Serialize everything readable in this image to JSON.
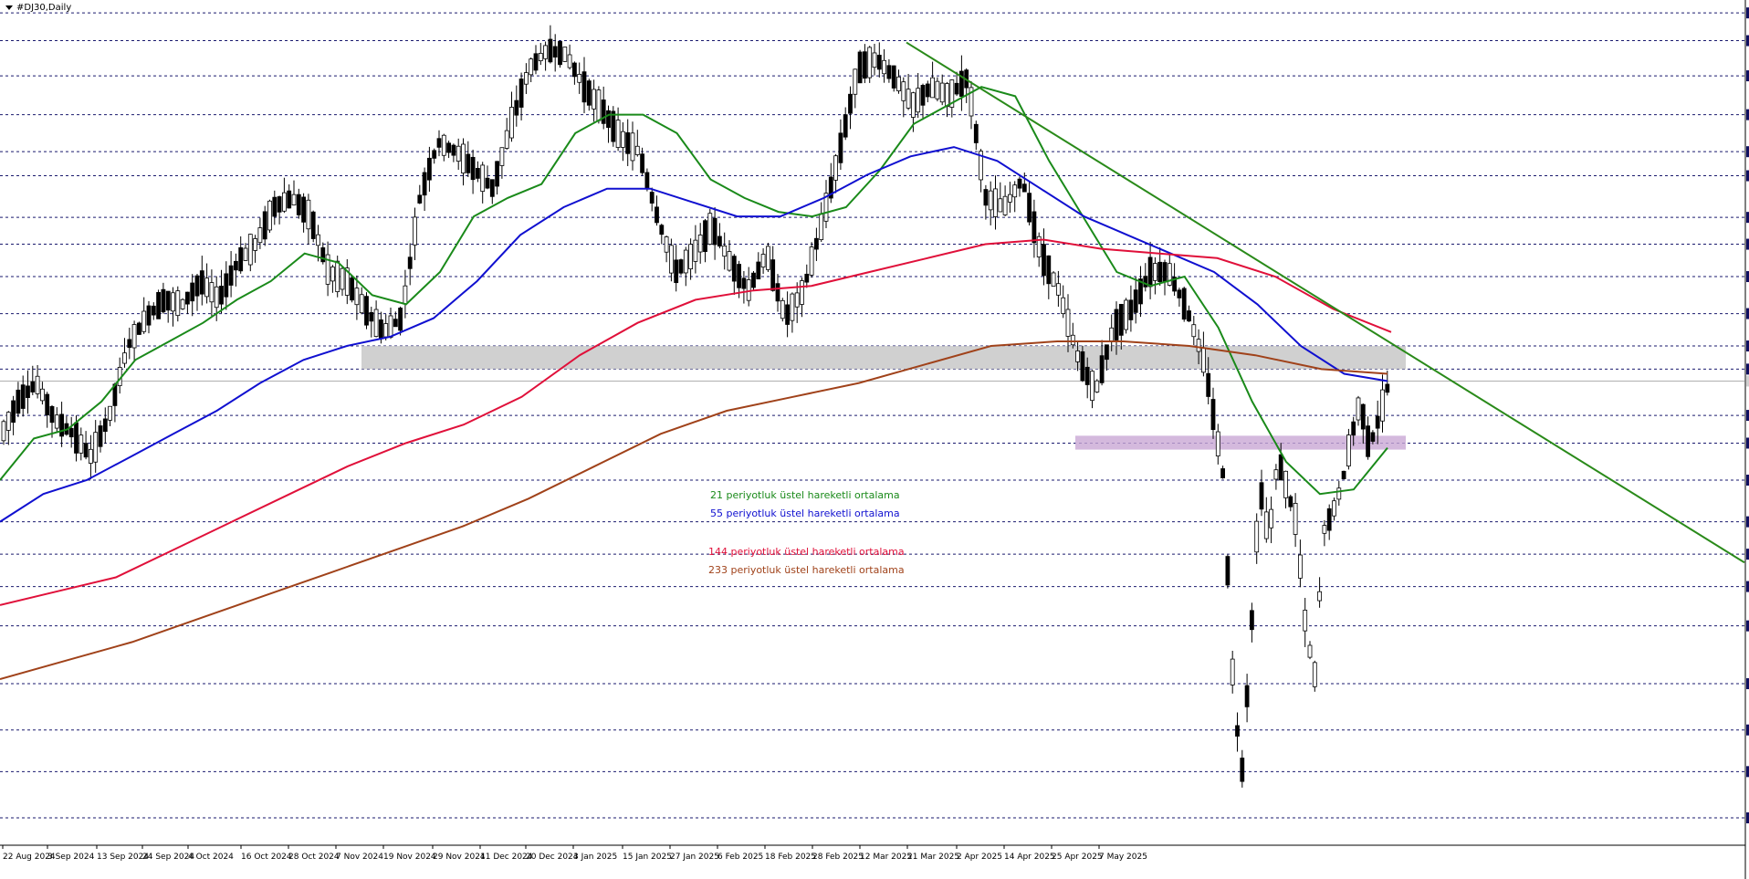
{
  "window": {
    "symbol_title": "#DJ30,Daily"
  },
  "colors": {
    "background": "#ffffff",
    "grid": "#1a1a6e",
    "bull_candle": "#ffffff",
    "bear_candle": "#000000",
    "ema21": "#1a8a1a",
    "ema55": "#1010d0",
    "ema144": "#e0103a",
    "ema233": "#a0421a",
    "trendline": "#2a8a1a",
    "resistance_zone": "#c8c8c8",
    "support_zone": "#c9a8d4",
    "price_label_bg": "#101060"
  },
  "legend": {
    "ema21": "21 periyotluk üstel hareketli ortalama",
    "ema55": "55 periyotluk üstel hareketli ortalama",
    "ema144": "144 periyotluk üstel hareketli ortalama",
    "ema233": "233 periyotluk üstel hareketli ortalama"
  },
  "chart_data": {
    "type": "candlestick",
    "title": "#DJ30,Daily",
    "y_range": [
      36514,
      45600
    ],
    "grid": true,
    "highlighted_levels": [
      45500,
      45200,
      44820,
      44400,
      44000,
      43740,
      43290,
      43000,
      42650,
      42250,
      41900,
      41650,
      41521,
      41150,
      40850,
      40450,
      40000,
      39650,
      39300,
      38875,
      38250,
      37750,
      37300,
      36800
    ],
    "minor_levels": [
      44569,
      44249,
      43924,
      43604,
      43284,
      42964,
      41994,
      41349,
      41024,
      40704,
      40379,
      40059,
      39739,
      39414,
      39094,
      38769,
      38449,
      38129,
      37804,
      37484,
      37159,
      36839,
      36514
    ],
    "current_price": 41521,
    "x_labels": [
      "22 Aug 2024",
      "3 Sep 2024",
      "13 Sep 2024",
      "24 Sep 2024",
      "4 Oct 2024",
      "16 Oct 2024",
      "28 Oct 2024",
      "7 Nov 2024",
      "19 Nov 2024",
      "29 Nov 2024",
      "11 Dec 2024",
      "20 Dec 2024",
      "3 Jan 2025",
      "15 Jan 2025",
      "27 Jan 2025",
      "6 Feb 2025",
      "18 Feb 2025",
      "28 Feb 2025",
      "12 Mar 2025",
      "21 Mar 2025",
      "2 Apr 2025",
      "14 Apr 2025",
      "25 Apr 2025",
      "7 May 2025"
    ],
    "zones": [
      {
        "name": "resistance",
        "from": 41650,
        "to": 41900,
        "start": "28 Oct 2024",
        "end": "7 May 2025"
      },
      {
        "name": "support",
        "from": 40780,
        "to": 40930,
        "start": "12 Mar 2025",
        "end": "7 May 2025"
      }
    ],
    "trendline": {
      "start_date": "6 Feb 2025",
      "start_value": 45180,
      "end_value": 39560
    },
    "series": [
      {
        "name": "21 periyotluk üstel hareketli ortalama",
        "values": [
          40450,
          40900,
          41000,
          41300,
          41750,
          41950,
          42150,
          42400,
          42600,
          42900,
          42800,
          42450,
          42350,
          42700,
          43300,
          43500,
          43650,
          44200,
          44400,
          44400,
          44200,
          43700,
          43500,
          43350,
          43300,
          43400,
          43800,
          44300,
          44500,
          44700,
          44600,
          43900,
          43300,
          42700,
          42550,
          42650,
          42100,
          41300,
          40650,
          40300,
          40350,
          40800
        ]
      },
      {
        "name": "55 periyotluk üstel hareketli ortalama",
        "values": [
          40000,
          40300,
          40450,
          40700,
          40950,
          41200,
          41500,
          41750,
          41900,
          42000,
          42200,
          42600,
          43100,
          43400,
          43600,
          43600,
          43450,
          43300,
          43300,
          43500,
          43750,
          43950,
          44050,
          43900,
          43600,
          43300,
          43100,
          42900,
          42700,
          42350,
          41900,
          41600,
          41521
        ]
      },
      {
        "name": "144 periyotluk üstel hareketli ortalama",
        "values": [
          39100,
          39250,
          39400,
          39700,
          40000,
          40300,
          40600,
          40850,
          41050,
          41350,
          41800,
          42150,
          42400,
          42500,
          42550,
          42700,
          42850,
          43000,
          43050,
          42950,
          42900,
          42850,
          42650,
          42300,
          42050
        ]
      },
      {
        "name": "233 periyotluk üstel hareketli ortalama",
        "values": [
          38300,
          38500,
          38700,
          38950,
          39200,
          39450,
          39700,
          39950,
          40250,
          40600,
          40950,
          41200,
          41350,
          41500,
          41700,
          41900,
          41950,
          41950,
          41900,
          41800,
          41650,
          41600
        ]
      }
    ]
  }
}
